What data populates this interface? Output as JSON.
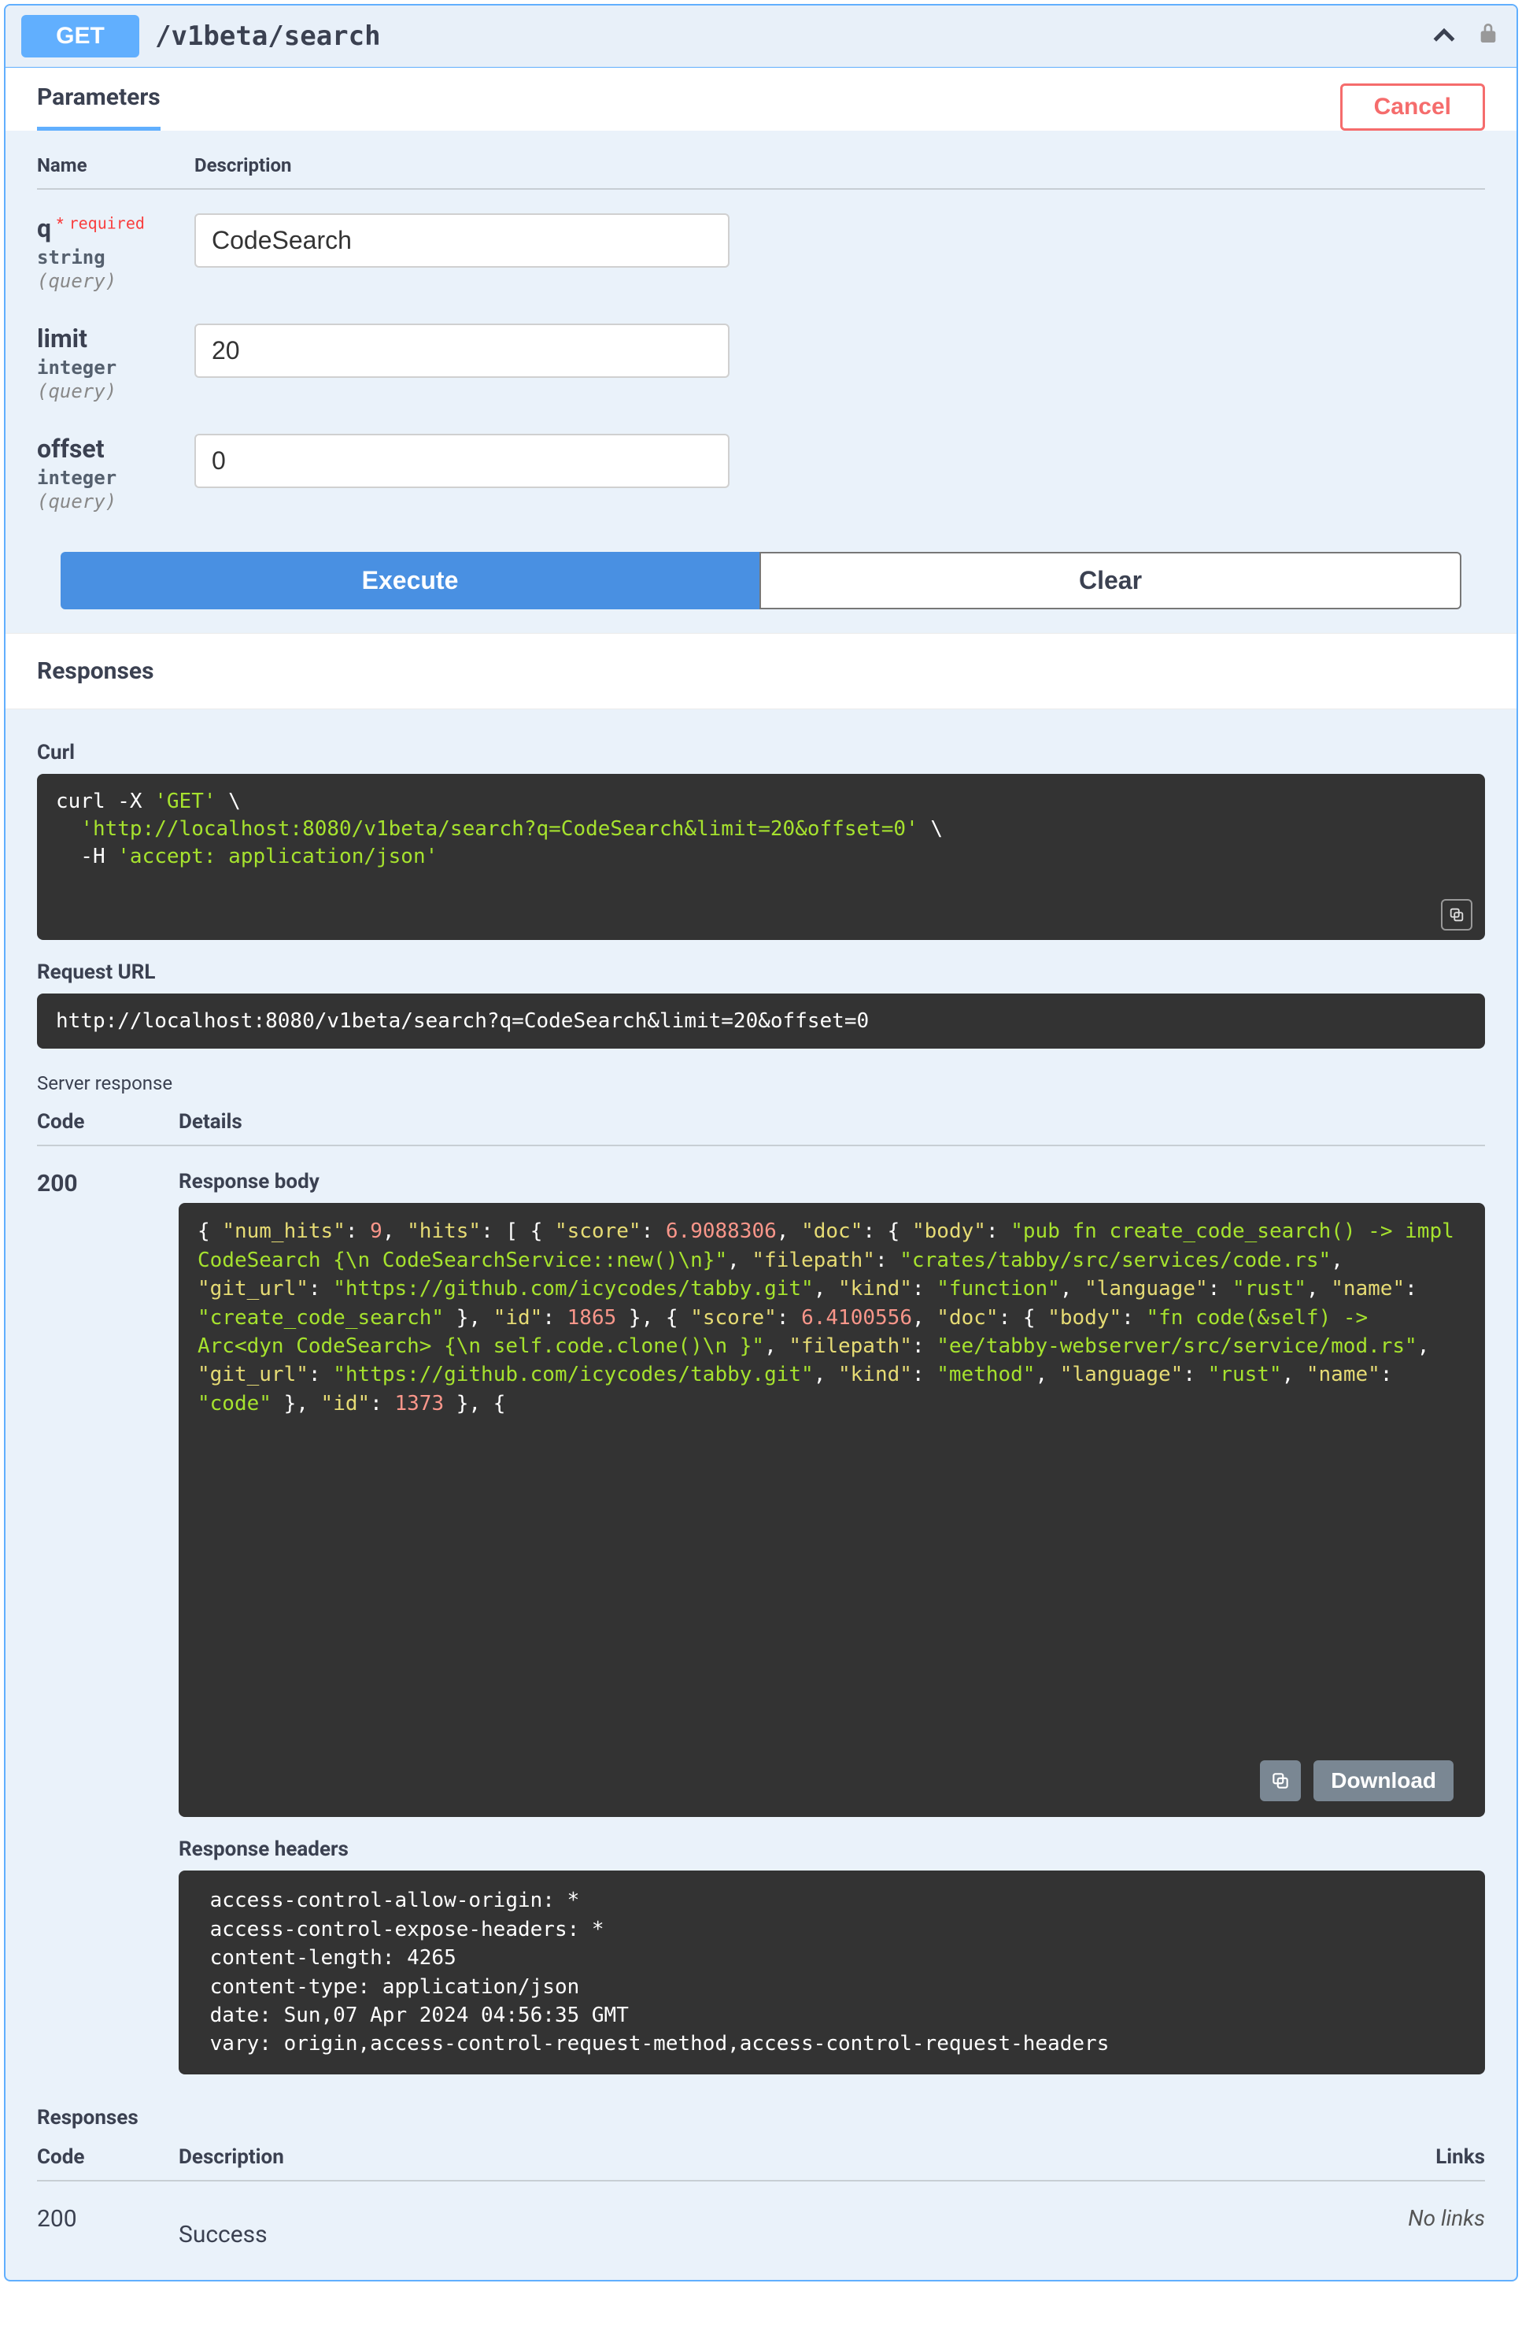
{
  "summary": {
    "method": "GET",
    "path": "/v1beta/search"
  },
  "tabs": {
    "parameters": "Parameters",
    "cancel": "Cancel"
  },
  "param_headers": {
    "name": "Name",
    "description": "Description"
  },
  "params": {
    "q": {
      "name": "q",
      "required_mark": "*",
      "required_text": "required",
      "type": "string",
      "in": "(query)",
      "value": "CodeSearch"
    },
    "limit": {
      "name": "limit",
      "type": "integer",
      "in": "(query)",
      "value": "20"
    },
    "offset": {
      "name": "offset",
      "type": "integer",
      "in": "(query)",
      "value": "0"
    }
  },
  "buttons": {
    "execute": "Execute",
    "clear": "Clear",
    "download": "Download"
  },
  "responses_label": "Responses",
  "curl": {
    "label": "Curl",
    "l1a": "curl -X ",
    "l1b": "'GET'",
    "l1c": " \\",
    "l2a": "  ",
    "l2b": "'http://localhost:8080/v1beta/search?q=CodeSearch&limit=20&offset=0'",
    "l2c": " \\",
    "l3a": "  -H ",
    "l3b": "'accept: application/json'"
  },
  "request_url": {
    "label": "Request URL",
    "value": "http://localhost:8080/v1beta/search?q=CodeSearch&limit=20&offset=0"
  },
  "server_response_label": "Server response",
  "resp_cols": {
    "code": "Code",
    "details": "Details",
    "links": "Links",
    "description": "Description"
  },
  "live": {
    "code": "200",
    "body_label": "Response body",
    "headers_label": "Response headers",
    "headers": " access-control-allow-origin: * \n access-control-expose-headers: * \n content-length: 4265 \n content-type: application/json \n date: Sun,07 Apr 2024 04:56:35 GMT \n vary: origin,access-control-request-method,access-control-request-headers "
  },
  "json": {
    "num_hits": "9",
    "h0_score": "6.9088306",
    "h0_body": "\"pub fn create_code_search() -> impl CodeSearch {\\n    CodeSearchService::new()\\n}\"",
    "h0_filepath": "\"crates/tabby/src/services/code.rs\"",
    "h0_git": "\"https://github.com/icycodes/tabby.git\"",
    "h0_kind": "\"function\"",
    "h0_lang": "\"rust\"",
    "h0_name": "\"create_code_search\"",
    "h0_id": "1865",
    "h1_score": "6.4100556",
    "h1_body": "\"fn code(&self) -> Arc<dyn CodeSearch> {\\n        self.code.clone()\\n    }\"",
    "h1_filepath": "\"ee/tabby-webserver/src/service/mod.rs\"",
    "h1_git": "\"https://github.com/icycodes/tabby.git\"",
    "h1_kind": "\"method\"",
    "h1_lang": "\"rust\"",
    "h1_name": "\"code\"",
    "h1_id": "1373"
  },
  "doc_responses": {
    "label": "Responses",
    "code": "200",
    "description": "Success",
    "links": "No links"
  }
}
